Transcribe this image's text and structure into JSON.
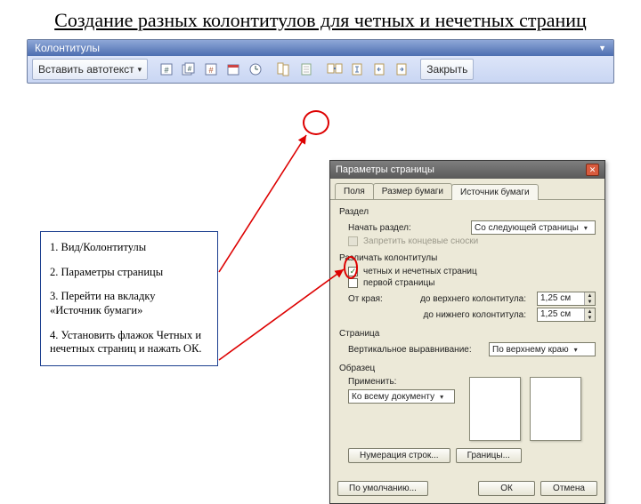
{
  "title": "Создание разных колонтитулов для четных и нечетных страниц",
  "toolbar": {
    "title": "Колонтитулы",
    "autotext": "Вставить автотекст",
    "close": "Закрыть"
  },
  "instructions": {
    "s1": "1. Вид/Колонтитулы",
    "s2": "2. Параметры страницы",
    "s3": "3. Перейти на вкладку «Источник бумаги»",
    "s4": "4. Установить флажок Четных и нечетных страниц и нажать ОК."
  },
  "dialog": {
    "title": "Параметры страницы",
    "tabs": {
      "t1": "Поля",
      "t2": "Размер бумаги",
      "t3": "Источник бумаги"
    },
    "section": {
      "group": "Раздел",
      "start_label": "Начать раздел:",
      "start_value": "Со следующей страницы",
      "suppress": "Запретить концевые сноски"
    },
    "headers": {
      "group": "Различать колонтитулы",
      "odd_even": "четных и нечетных страниц",
      "first_page": "первой страницы",
      "from_edge": "От края:",
      "top_label": "до верхнего колонтитула:",
      "top_value": "1,25 см",
      "bottom_label": "до нижнего колонтитула:",
      "bottom_value": "1,25 см"
    },
    "page": {
      "group": "Страница",
      "valign_label": "Вертикальное выравнивание:",
      "valign_value": "По верхнему краю"
    },
    "preview": {
      "group": "Образец",
      "apply_label": "Применить:",
      "apply_value": "Ко всему документу"
    },
    "buttons": {
      "lines": "Нумерация строк...",
      "borders": "Границы...",
      "default": "По умолчанию...",
      "ok": "ОК",
      "cancel": "Отмена"
    }
  }
}
